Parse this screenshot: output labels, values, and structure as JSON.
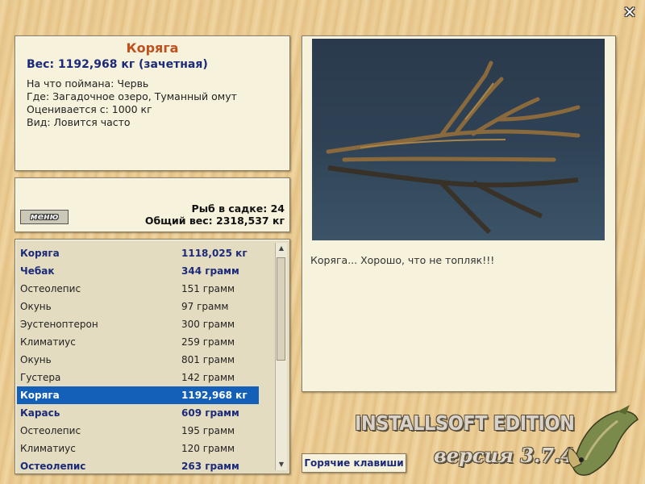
{
  "info": {
    "name": "Коряга",
    "weight": "Вес: 1192,968 кг (зачетная)",
    "bait": "На что поймана: Червь",
    "place": "Где: Загадочное озеро, Туманный омут",
    "value": "Оценивается с: 1000 кг",
    "kind": "Вид: Ловится часто"
  },
  "keepnet": {
    "menu_label": "меню",
    "fish_count": "Рыб в садке: 24",
    "total_weight": "Общий вес: 2318,537 кг"
  },
  "catch_list": [
    {
      "name": "Коряга",
      "weight": "1118,025 кг",
      "style": "bold"
    },
    {
      "name": "Чебак",
      "weight": "344 грамм",
      "style": "bold"
    },
    {
      "name": "Остеолепис",
      "weight": "151 грамм",
      "style": "normal"
    },
    {
      "name": "Окунь",
      "weight": "97 грамм",
      "style": "normal"
    },
    {
      "name": "Эустеноптерон",
      "weight": "300 грамм",
      "style": "normal"
    },
    {
      "name": "Климатиус",
      "weight": "259 грамм",
      "style": "normal"
    },
    {
      "name": "Окунь",
      "weight": "801 грамм",
      "style": "normal"
    },
    {
      "name": "Густера",
      "weight": "142 грамм",
      "style": "normal"
    },
    {
      "name": "Коряга",
      "weight": "1192,968 кг",
      "style": "selected"
    },
    {
      "name": "Карась",
      "weight": "609 грамм",
      "style": "bold"
    },
    {
      "name": "Остеолепис",
      "weight": "195 грамм",
      "style": "normal"
    },
    {
      "name": "Климатиус",
      "weight": "120 грамм",
      "style": "normal"
    },
    {
      "name": "Остеолепис",
      "weight": "263 грамм",
      "style": "bold"
    }
  ],
  "photo": {
    "caption": "Коряга... Хорошо, что не топляк!!!"
  },
  "hotkeys_label": "Горячие клавиши",
  "edition_label": "INSTALLSOFT EDITION",
  "version_label": "версия 3.7.4",
  "colors": {
    "selection": "#1460b8",
    "name_accent": "#c0501e",
    "bold_text": "#1c2a7a"
  }
}
